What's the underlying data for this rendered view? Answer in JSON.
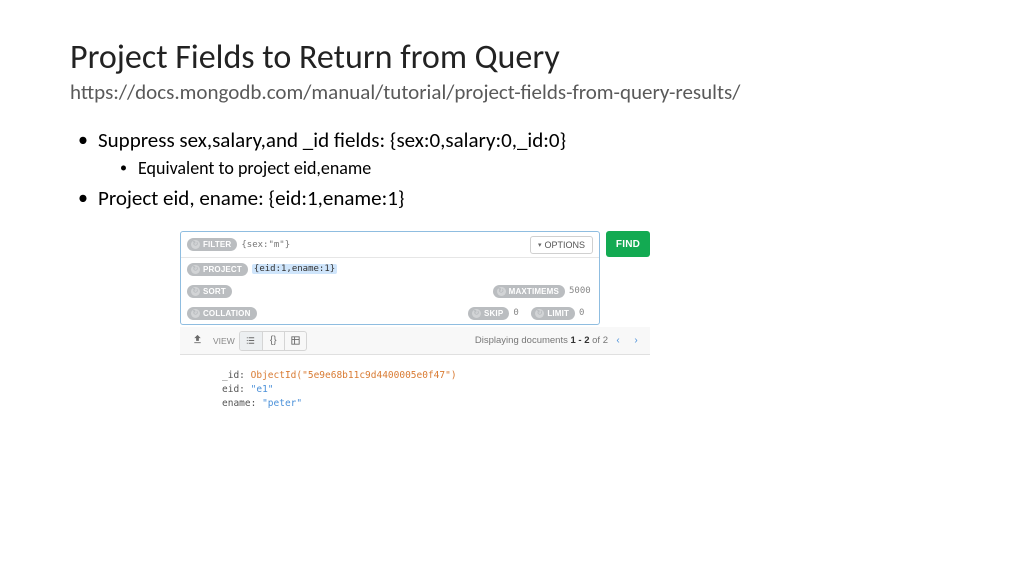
{
  "title": "Project Fields to Return from Query",
  "subtitle": "https://docs.mongodb.com/manual/tutorial/project-fields-from-query-results/",
  "bullets": {
    "b1": "Suppress sex,salary,and _id fields: {sex:0,salary:0,_id:0}",
    "b1sub": "Equivalent to project eid,ename",
    "b2": "Project eid, ename:  {eid:1,ename:1}"
  },
  "query": {
    "filter_label": "FILTER",
    "filter_value": "{sex:\"m\"}",
    "project_label": "PROJECT",
    "project_value": "{eid:1,ename:1}",
    "sort_label": "SORT",
    "maxtimems_label": "MAXTIMEMS",
    "maxtimems_value": "5000",
    "collation_label": "COLLATION",
    "skip_label": "SKIP",
    "skip_value": "0",
    "limit_label": "LIMIT",
    "limit_value": "0",
    "options_label": "OPTIONS",
    "find_label": "FIND"
  },
  "toolbar": {
    "view_label": "VIEW",
    "display_prefix": "Displaying documents ",
    "display_range": "1 - 2",
    "display_mid": " of ",
    "display_total": "2"
  },
  "doc": {
    "k_id": "_id",
    "oid_fn": "ObjectId(",
    "oid_val": "\"5e9e68b11c9d4400005e0f47\"",
    "oid_close": ")",
    "k_eid": "eid",
    "v_eid": "\"e1\"",
    "k_ename": "ename",
    "v_ename": "\"peter\""
  }
}
